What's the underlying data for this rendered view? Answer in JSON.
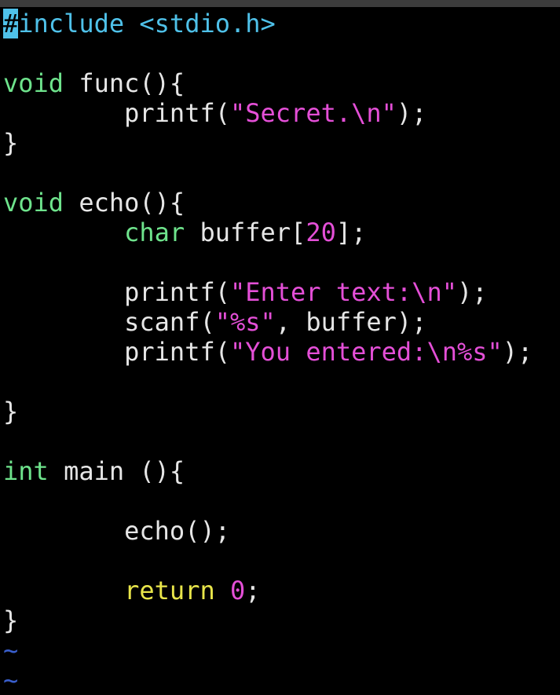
{
  "colors": {
    "background": "#000000",
    "default_text": "#e6e6e6",
    "preproc": "#4fc1e9",
    "type_keyword": "#6ee38c",
    "string": "#e44fd7",
    "number": "#e44fd7",
    "statement": "#e8e54a",
    "cursor_bg": "#4fc1e9",
    "tilde": "#3a5fcd"
  },
  "editor": {
    "lines": [
      [
        {
          "t": "#",
          "c": "cursor"
        },
        {
          "t": "include <stdio.h>",
          "c": "preproc"
        }
      ],
      [],
      [
        {
          "t": "void",
          "c": "type_keyword"
        },
        {
          "t": " func(){",
          "c": "default_text"
        }
      ],
      [
        {
          "t": "        printf(",
          "c": "default_text"
        },
        {
          "t": "\"Secret.\\n\"",
          "c": "string"
        },
        {
          "t": ");",
          "c": "default_text"
        }
      ],
      [
        {
          "t": "}",
          "c": "default_text"
        }
      ],
      [],
      [
        {
          "t": "void",
          "c": "type_keyword"
        },
        {
          "t": " echo(){",
          "c": "default_text"
        }
      ],
      [
        {
          "t": "        ",
          "c": "default_text"
        },
        {
          "t": "char",
          "c": "type_keyword"
        },
        {
          "t": " buffer[",
          "c": "default_text"
        },
        {
          "t": "20",
          "c": "number"
        },
        {
          "t": "];",
          "c": "default_text"
        }
      ],
      [],
      [
        {
          "t": "        printf(",
          "c": "default_text"
        },
        {
          "t": "\"Enter text:\\n\"",
          "c": "string"
        },
        {
          "t": ");",
          "c": "default_text"
        }
      ],
      [
        {
          "t": "        scanf(",
          "c": "default_text"
        },
        {
          "t": "\"%s\"",
          "c": "string"
        },
        {
          "t": ", buffer);",
          "c": "default_text"
        }
      ],
      [
        {
          "t": "        printf(",
          "c": "default_text"
        },
        {
          "t": "\"You entered:\\n%s\"",
          "c": "string"
        },
        {
          "t": ");",
          "c": "default_text"
        }
      ],
      [],
      [
        {
          "t": "}",
          "c": "default_text"
        }
      ],
      [],
      [
        {
          "t": "int",
          "c": "type_keyword"
        },
        {
          "t": " main (){",
          "c": "default_text"
        }
      ],
      [],
      [
        {
          "t": "        echo();",
          "c": "default_text"
        }
      ],
      [],
      [
        {
          "t": "        ",
          "c": "default_text"
        },
        {
          "t": "return",
          "c": "statement"
        },
        {
          "t": " ",
          "c": "default_text"
        },
        {
          "t": "0",
          "c": "number"
        },
        {
          "t": ";",
          "c": "default_text"
        }
      ],
      [
        {
          "t": "}",
          "c": "default_text"
        }
      ],
      [
        {
          "t": "~",
          "c": "tilde"
        }
      ],
      [
        {
          "t": "~",
          "c": "tilde"
        }
      ]
    ]
  }
}
